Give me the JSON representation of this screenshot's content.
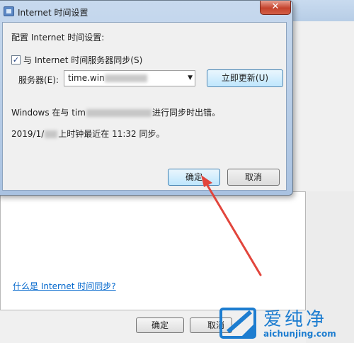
{
  "dialog": {
    "title": "Internet 时间设置",
    "close_label": "✕",
    "heading": "配置 Internet 时间设置:",
    "sync_checkbox": {
      "checked": true,
      "label": "与 Internet 时间服务器同步(S)"
    },
    "server_label": "服务器(E):",
    "server_value": "time.win",
    "update_button": "立即更新(U)",
    "status_error_prefix": "Windows 在与 tim",
    "status_error_suffix": "进行同步时出错。",
    "status_last_prefix": "2019/1/",
    "status_last_suffix": "上时钟最近在 11:32 同步。",
    "ok_button": "确定",
    "cancel_button": "取消"
  },
  "background_dialog": {
    "help_link": "什么是 Internet 时间同步?",
    "ok_button": "确定",
    "cancel_button": "取消"
  },
  "watermark": {
    "title": "爱纯净",
    "url": "aichunjing.com"
  },
  "colors": {
    "accent_blue": "#1d7dd0",
    "arrow_red": "#e2453c",
    "link_blue": "#0066cc"
  }
}
